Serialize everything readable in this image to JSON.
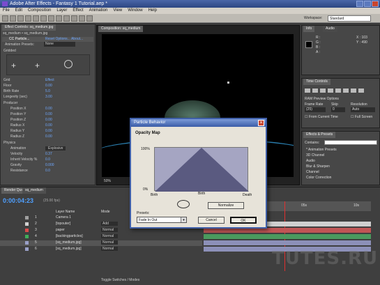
{
  "window": {
    "title": "Adobe After Effects - Fantasy 1 Tutorial.aep *"
  },
  "menu": [
    "File",
    "Edit",
    "Composition",
    "Layer",
    "Effect",
    "Animation",
    "View",
    "Window",
    "Help"
  ],
  "toolbar": {
    "workspace_label": "Workspace:",
    "workspace_value": "Standard"
  },
  "effect_controls": {
    "tab": "Effect Controls: sq_medium.jpg",
    "layer": "sq_medium • sq_medium.jpg",
    "effect_name": "CC Particle...",
    "effect_links": "Reset  Options...  About...",
    "animation_preset_label": "Animation Presets:",
    "animation_preset_value": "None",
    "rows": [
      {
        "label": "Gridded",
        "value": ""
      },
      {
        "label": "Scenario",
        "value": ""
      },
      {
        "label": "Grid",
        "value": "Effect"
      },
      {
        "label": "Floor",
        "value": "0.00"
      },
      {
        "label": "Birth Rate",
        "value": "5.0"
      },
      {
        "label": "Longevity (sec)",
        "value": "3.00"
      },
      {
        "label": "Producer",
        "value": ""
      },
      {
        "label": "Position X",
        "value": "0.00"
      },
      {
        "label": "Position Y",
        "value": "0.00"
      },
      {
        "label": "Position Z",
        "value": "0.00"
      },
      {
        "label": "Radius X",
        "value": "0.00"
      },
      {
        "label": "Radius Y",
        "value": "0.00"
      },
      {
        "label": "Radius Z",
        "value": "0.00"
      },
      {
        "label": "Physics",
        "value": ""
      },
      {
        "label": "Animation",
        "value": "Explosive"
      },
      {
        "label": "Velocity",
        "value": "0.37"
      },
      {
        "label": "Inherit Velocity %",
        "value": "0.0"
      },
      {
        "label": "Gravity",
        "value": "0.000"
      },
      {
        "label": "Resistance",
        "value": "0.0"
      }
    ]
  },
  "composition": {
    "tab": "Composition: sq_medium",
    "zoom": "50%"
  },
  "info_panel": {
    "tabs": [
      "Info",
      "Audio"
    ],
    "r": "R :",
    "g": "G :",
    "b": "B :",
    "a": "A :",
    "x": "X : 103",
    "y": "Y : 490"
  },
  "time_controls": {
    "tab": "Time Controls",
    "ram_preview": "RAM Preview Options",
    "frame_rate_label": "Frame Rate",
    "skip_label": "Skip",
    "resolution_label": "Resolution",
    "frame_rate": "(25)",
    "skip": "0",
    "resolution": "Auto",
    "from_current": "From Current Time",
    "full_screen": "Full Screen"
  },
  "effects_presets": {
    "tab": "Effects & Presets",
    "contains_label": "Contains:",
    "items": [
      "* Animation Presets",
      "3D Channel",
      "Audio",
      "Blur & Sharpen",
      "Channel",
      "Color Correction"
    ]
  },
  "timeline": {
    "tabs": [
      "Render Queue",
      "sq_medium"
    ],
    "timecode": "0:00:04:23",
    "fps": "(25.00 fps)",
    "col_source": "Layer Name",
    "col_mode": "Mode",
    "toggle": "Toggle Switches / Modes",
    "layers": [
      {
        "num": "1",
        "name": "Camera 1",
        "mode": "",
        "color": "#a0a0a0"
      },
      {
        "num": "2",
        "name": "[topouter]",
        "mode": "Add",
        "color": "#d0d0d0"
      },
      {
        "num": "3",
        "name": "paper",
        "mode": "Normal",
        "color": "#d94a4a"
      },
      {
        "num": "4",
        "name": "[backingparticles]",
        "mode": "Normal",
        "color": "#3fae5a"
      },
      {
        "num": "5",
        "name": "[sq_medium.jpg]",
        "mode": "Normal",
        "color": "#9aa0c8"
      },
      {
        "num": "6",
        "name": "[sq_medium.jpg]",
        "mode": "Normal",
        "color": "#9aa0c8"
      }
    ],
    "ruler": [
      "0s",
      "05s",
      "10s"
    ]
  },
  "dialog": {
    "title": "Particle Behavior",
    "heading": "Opacity Map",
    "y_top": "100%",
    "y_bottom": "0%",
    "x_left": "Birth",
    "x_mid": "Birth",
    "x_right": "Death",
    "normalize": "Normalize",
    "presets_label": "Presets:",
    "preset_value": "Fade In Out",
    "cancel": "Cancel",
    "ok": "OK"
  },
  "watermark": "TUTES.RU"
}
